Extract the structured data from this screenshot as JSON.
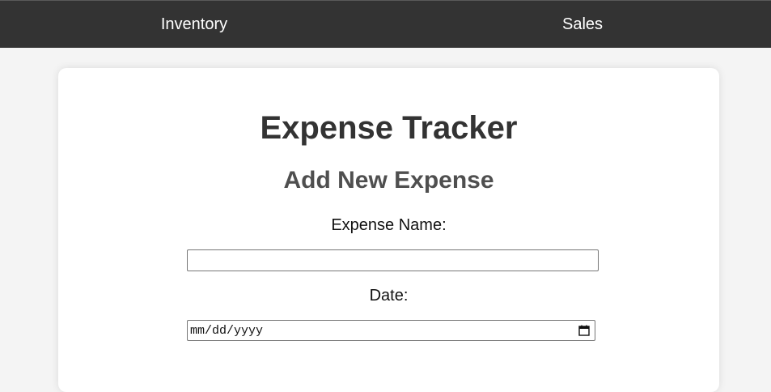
{
  "nav": {
    "inventory_label": "Inventory",
    "sales_label": "Sales"
  },
  "card": {
    "title": "Expense Tracker",
    "section_title": "Add New Expense",
    "form": {
      "expense_name_label": "Expense Name:",
      "expense_name_value": "",
      "date_label": "Date:",
      "date_placeholder": "mm/dd/yyyy",
      "date_icon": "calendar-icon"
    }
  },
  "colors": {
    "nav_background": "#333333",
    "page_background": "#f4f4f4",
    "card_background": "#ffffff",
    "title_text": "#333333",
    "section_title_text": "#4f4f4f"
  }
}
